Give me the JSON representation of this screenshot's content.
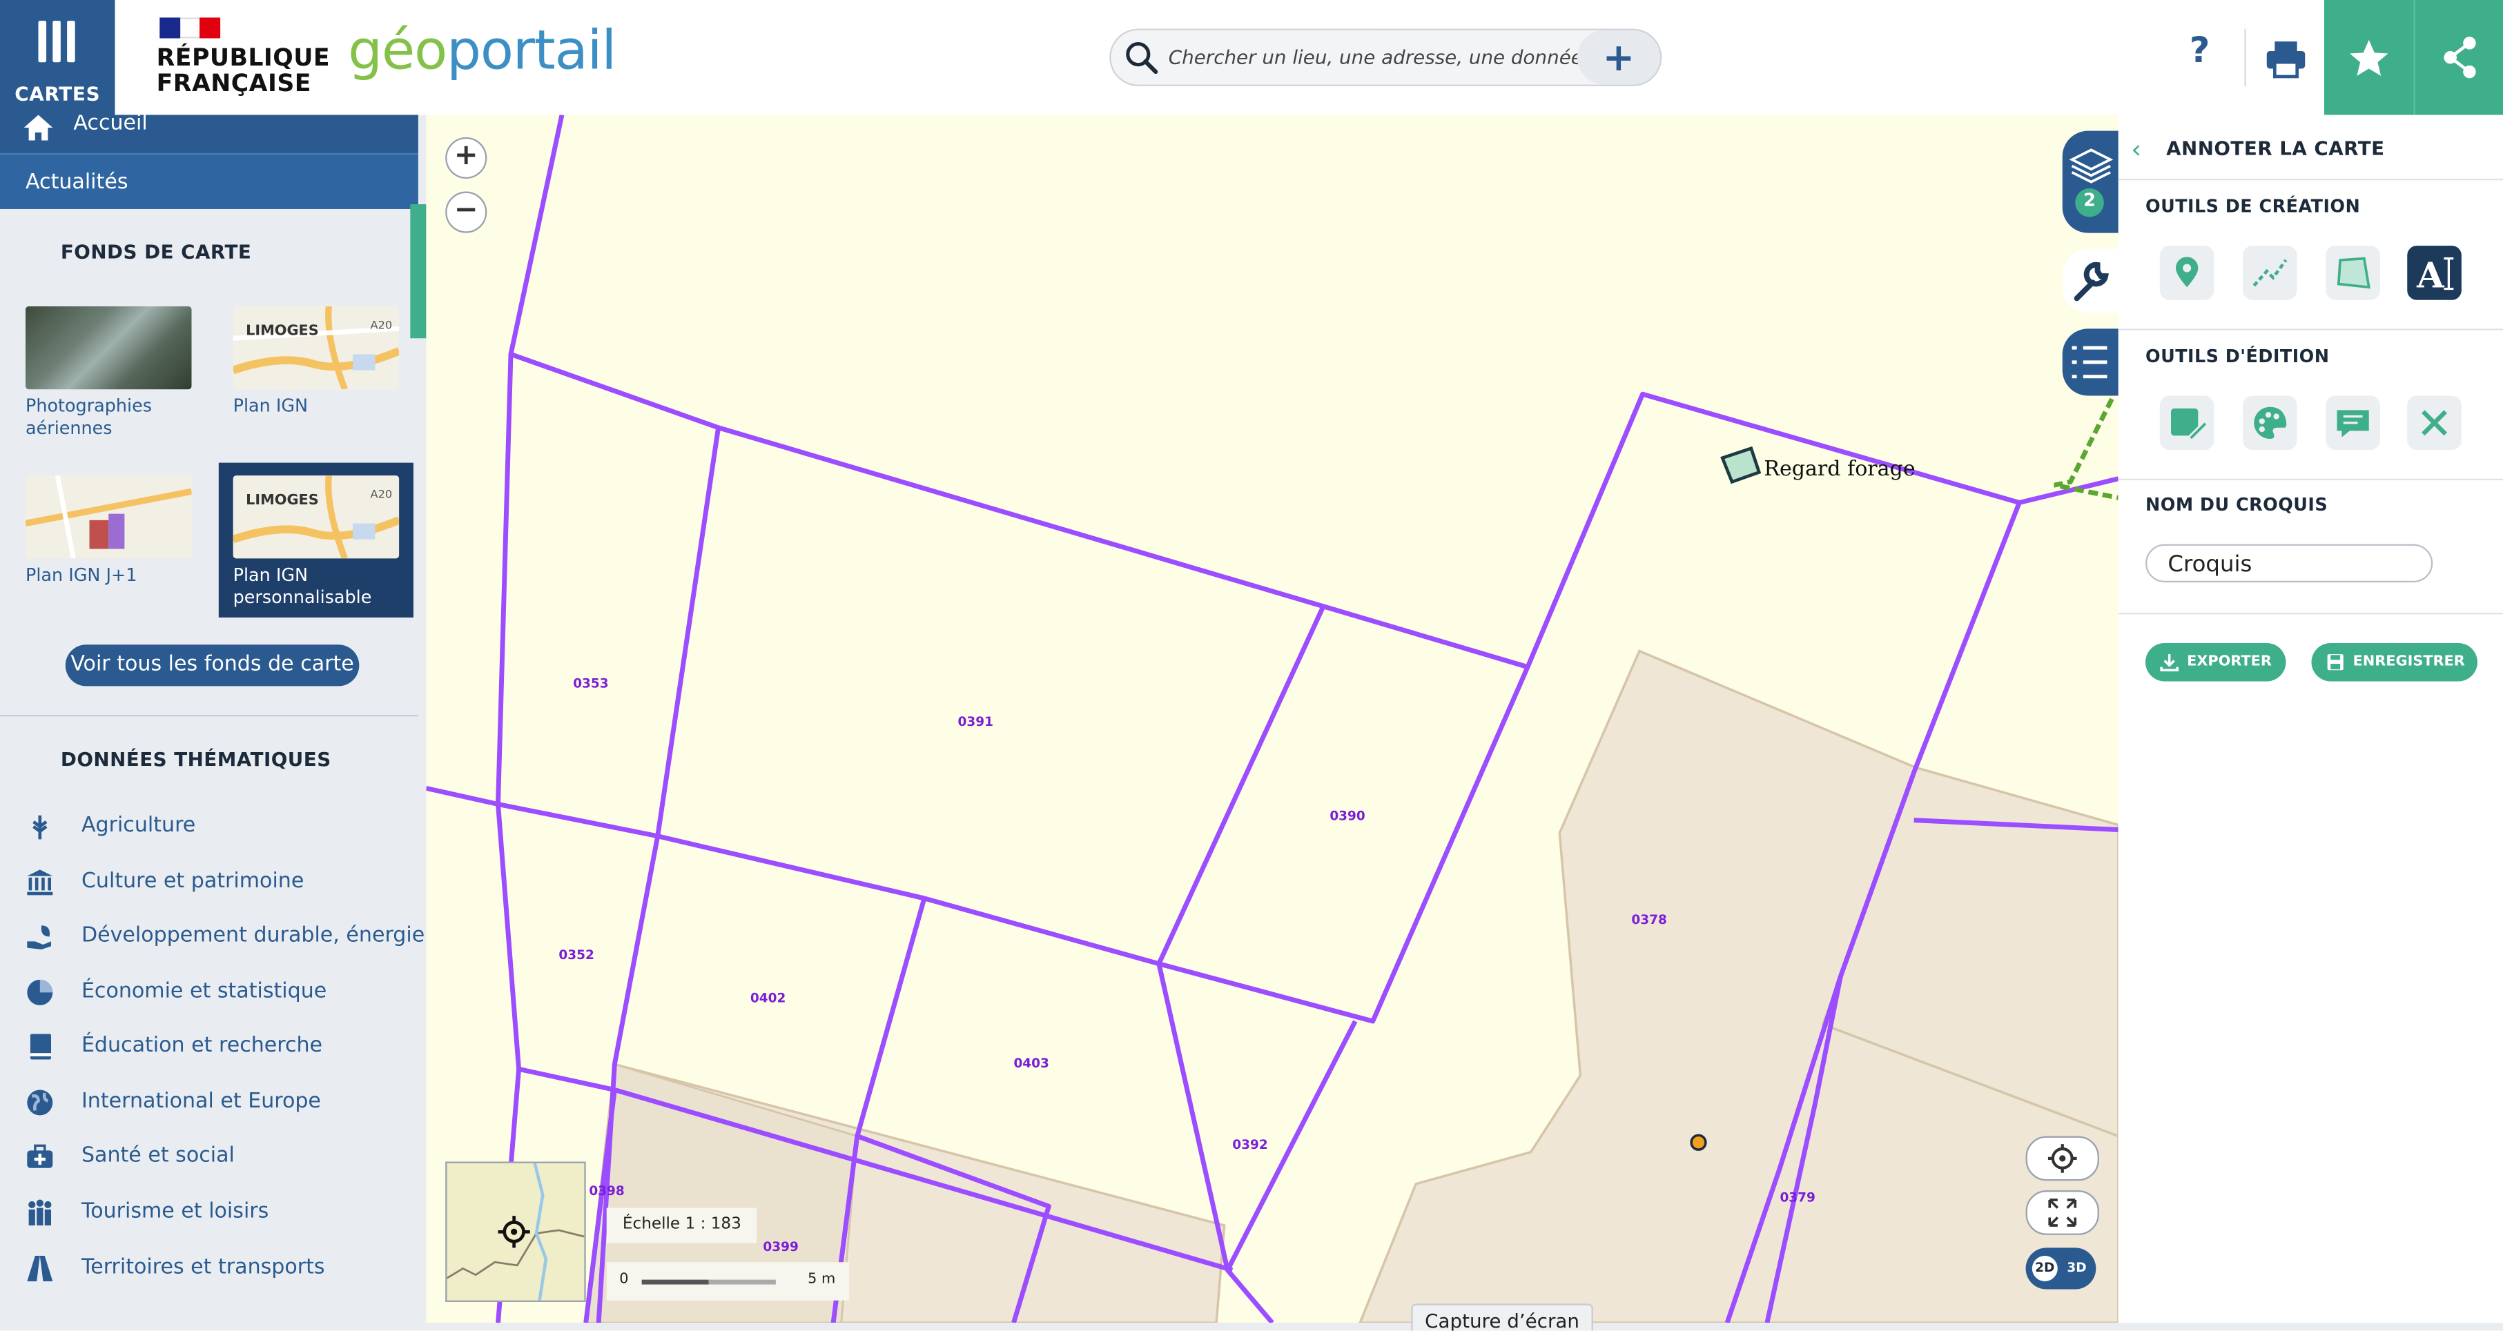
{
  "header": {
    "menu_label": "CARTES",
    "republic_line1": "RÉPUBLIQUE",
    "republic_line2": "FRANÇAISE",
    "logo_part1": "géo",
    "logo_part2": "portail",
    "search_placeholder": "Chercher un lieu, une adresse, une donnée",
    "search_add": "+",
    "help": "?"
  },
  "nav": {
    "home": "Accueil",
    "news": "Actualités"
  },
  "basemaps": {
    "heading": "FONDS DE CARTE",
    "items": [
      {
        "label": "Photographies aériennes"
      },
      {
        "label": "Plan IGN"
      },
      {
        "label": "Plan IGN J+1"
      },
      {
        "label": "Plan IGN personnalisable",
        "selected": true
      }
    ],
    "thumb_text": "LIMOGES",
    "thumb_road": "A20",
    "see_all": "Voir tous les fonds de carte"
  },
  "themes": {
    "heading": "DONNÉES THÉMATIQUES",
    "items": [
      {
        "label": "Agriculture",
        "icon": "wheat-icon"
      },
      {
        "label": "Culture et patrimoine",
        "icon": "monument-icon"
      },
      {
        "label": "Développement durable, énergie",
        "icon": "leaf-hand-icon"
      },
      {
        "label": "Économie et statistique",
        "icon": "pie-chart-icon"
      },
      {
        "label": "Éducation et recherche",
        "icon": "book-icon"
      },
      {
        "label": "International et Europe",
        "icon": "globe-icon"
      },
      {
        "label": "Santé et social",
        "icon": "medical-case-icon"
      },
      {
        "label": "Tourisme et loisirs",
        "icon": "people-icon"
      },
      {
        "label": "Territoires et transports",
        "icon": "road-icon"
      }
    ]
  },
  "map": {
    "parcels": [
      "0353",
      "0391",
      "0390",
      "0378",
      "0352",
      "0402",
      "0403",
      "0392",
      "0398",
      "0399",
      "0379"
    ],
    "annotation": "Regard forage",
    "scale_label": "Échelle 1 : 183",
    "scale_min": "0",
    "scale_max": "5 m",
    "layers_count": "2",
    "mode_2d": "2D",
    "mode_3d": "3D",
    "capture_tab": "Capture d’écran",
    "colors": {
      "parcel_line": "#9b4dff",
      "building": "#efe6d6",
      "background": "#fefde6"
    }
  },
  "panel": {
    "title": "ANNOTER LA CARTE",
    "creation_heading": "OUTILS DE CRÉATION",
    "edition_heading": "OUTILS D'ÉDITION",
    "name_heading": "NOM DU CROQUIS",
    "sketch_name": "Croquis",
    "export_label": "EXPORTER",
    "save_label": "ENREGISTRER",
    "accent": "#3fae8a"
  }
}
